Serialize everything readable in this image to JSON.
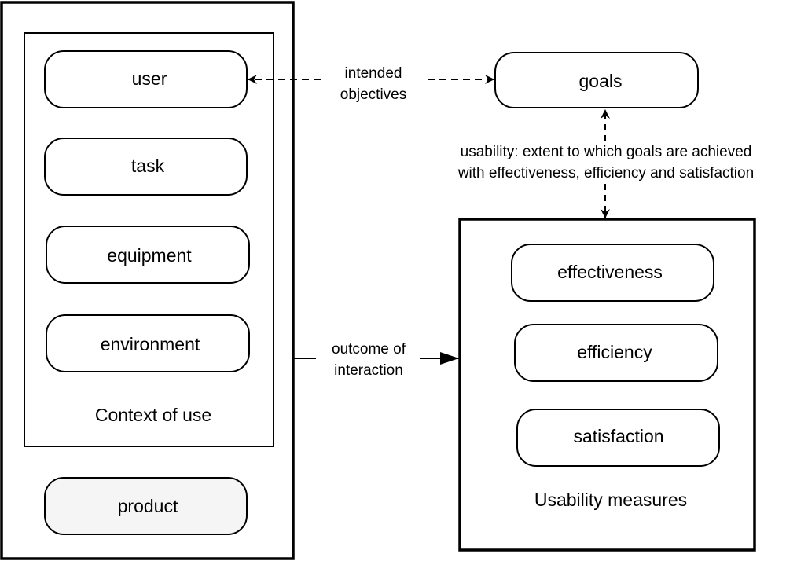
{
  "context": {
    "title": "Context of use",
    "items": [
      "user",
      "task",
      "equipment",
      "environment"
    ]
  },
  "product": {
    "label": "product",
    "fill": "#f5f5f5"
  },
  "goals": {
    "label": "goals"
  },
  "measures": {
    "title": "Usability measures",
    "items": [
      "effectiveness",
      "efficiency",
      "satisfaction"
    ]
  },
  "connectors": {
    "intended": [
      "intended",
      "objectives"
    ],
    "usability": [
      "usability: extent to which goals are achieved",
      "with effectiveness, efficiency and satisfaction"
    ],
    "outcome": [
      "outcome of",
      "interaction"
    ]
  }
}
